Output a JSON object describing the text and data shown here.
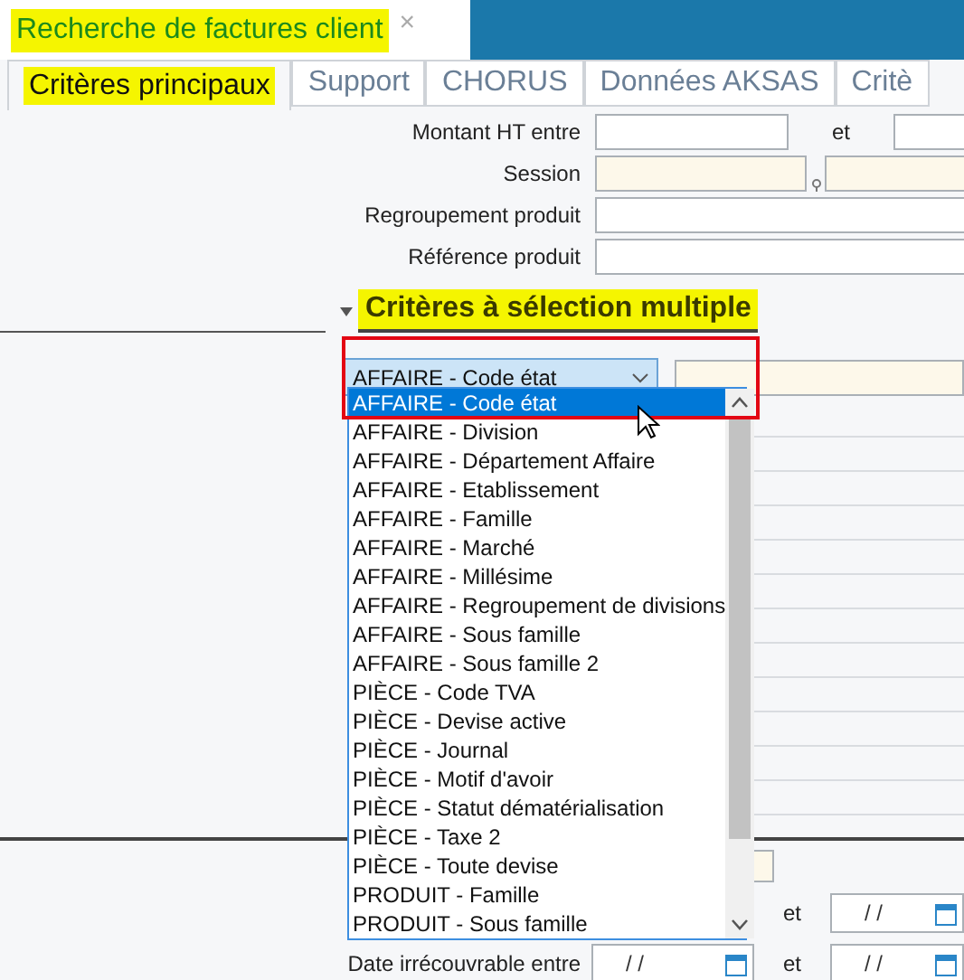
{
  "title_tab": {
    "title": "Recherche de factures client",
    "close": "×"
  },
  "tabs": [
    {
      "label": "Critères principaux",
      "selected": true
    },
    {
      "label": "Support",
      "selected": false
    },
    {
      "label": "CHORUS",
      "selected": false
    },
    {
      "label": "Données AKSAS",
      "selected": false
    },
    {
      "label": "Critè",
      "selected": false
    }
  ],
  "form_rows": [
    {
      "label": "Montant HT entre",
      "kind": "range",
      "joiner": "et"
    },
    {
      "label": "Session",
      "kind": "lookup"
    },
    {
      "label": "Regroupement produit",
      "kind": "text"
    },
    {
      "label": "Référence produit",
      "kind": "text"
    }
  ],
  "section": {
    "title": "Critères à sélection multiple",
    "expanded": true
  },
  "combo": {
    "value": "AFFAIRE - Code état",
    "expanded": true
  },
  "dropdown": {
    "items": [
      {
        "label": "AFFAIRE - Code état",
        "selected": true
      },
      {
        "label": "AFFAIRE - Division",
        "selected": false
      },
      {
        "label": "AFFAIRE - Département Affaire",
        "selected": false
      },
      {
        "label": "AFFAIRE - Etablissement",
        "selected": false
      },
      {
        "label": "AFFAIRE - Famille",
        "selected": false
      },
      {
        "label": "AFFAIRE - Marché",
        "selected": false
      },
      {
        "label": "AFFAIRE - Millésime",
        "selected": false
      },
      {
        "label": "AFFAIRE - Regroupement de divisions",
        "selected": false
      },
      {
        "label": "AFFAIRE - Sous famille",
        "selected": false
      },
      {
        "label": "AFFAIRE - Sous famille 2",
        "selected": false
      },
      {
        "label": "PIÈCE - Code TVA",
        "selected": false
      },
      {
        "label": "PIÈCE - Devise active",
        "selected": false
      },
      {
        "label": "PIÈCE - Journal",
        "selected": false
      },
      {
        "label": "PIÈCE - Motif d'avoir",
        "selected": false
      },
      {
        "label": "PIÈCE - Statut dématérialisation",
        "selected": false
      },
      {
        "label": "PIÈCE - Taxe 2",
        "selected": false
      },
      {
        "label": "PIÈCE - Toute devise",
        "selected": false
      },
      {
        "label": "PRODUIT - Famille",
        "selected": false
      },
      {
        "label": "PRODUIT - Sous famille",
        "selected": false
      }
    ]
  },
  "date_rows": [
    {
      "joiner": "et",
      "to": "/ /"
    },
    {
      "label": "Date irrécouvrable entre",
      "from": "/ /",
      "joiner": "et",
      "to": "/ /"
    }
  ]
}
